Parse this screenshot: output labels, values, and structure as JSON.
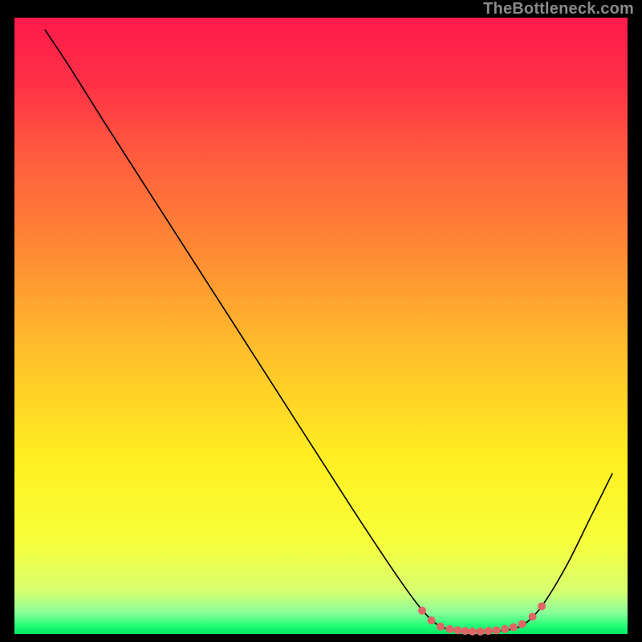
{
  "watermark": {
    "text": "TheBottleneck.com"
  },
  "chart_data": {
    "type": "line",
    "title": "",
    "xlabel": "",
    "ylabel": "",
    "xlim": [
      0,
      100
    ],
    "ylim": [
      0,
      100
    ],
    "grid": false,
    "legend": false,
    "background": {
      "type": "vertical-gradient",
      "stops": [
        {
          "pos": 0.0,
          "color": "#ff1a4b"
        },
        {
          "pos": 0.1,
          "color": "#ff2f47"
        },
        {
          "pos": 0.22,
          "color": "#ff5a3f"
        },
        {
          "pos": 0.38,
          "color": "#ff8a34"
        },
        {
          "pos": 0.55,
          "color": "#ffc22a"
        },
        {
          "pos": 0.72,
          "color": "#fff022"
        },
        {
          "pos": 0.85,
          "color": "#f7ff3a"
        },
        {
          "pos": 0.93,
          "color": "#d8ff70"
        },
        {
          "pos": 0.965,
          "color": "#8cff9a"
        },
        {
          "pos": 0.985,
          "color": "#2aff7a"
        },
        {
          "pos": 1.0,
          "color": "#00e865"
        }
      ]
    },
    "series": [
      {
        "name": "bottleneck-curve",
        "color": "#000000",
        "width": 1.6,
        "data": [
          {
            "x": 5.0,
            "y": 98.0
          },
          {
            "x": 9.0,
            "y": 92.0
          },
          {
            "x": 15.0,
            "y": 82.5
          },
          {
            "x": 25.0,
            "y": 67.0
          },
          {
            "x": 35.0,
            "y": 51.5
          },
          {
            "x": 45.0,
            "y": 36.0
          },
          {
            "x": 55.0,
            "y": 20.5
          },
          {
            "x": 62.0,
            "y": 10.0
          },
          {
            "x": 66.0,
            "y": 4.5
          },
          {
            "x": 69.0,
            "y": 1.5
          },
          {
            "x": 72.0,
            "y": 0.6
          },
          {
            "x": 76.0,
            "y": 0.4
          },
          {
            "x": 80.0,
            "y": 0.6
          },
          {
            "x": 83.0,
            "y": 1.5
          },
          {
            "x": 86.0,
            "y": 4.5
          },
          {
            "x": 90.0,
            "y": 11.0
          },
          {
            "x": 94.0,
            "y": 19.0
          },
          {
            "x": 97.5,
            "y": 26.0
          }
        ]
      }
    ],
    "markers": {
      "name": "optimal-zone-markers",
      "color": "#e06666",
      "radius": 5,
      "data": [
        {
          "x": 66.5,
          "y": 3.8
        },
        {
          "x": 68.0,
          "y": 2.2
        },
        {
          "x": 69.5,
          "y": 1.2
        },
        {
          "x": 71.0,
          "y": 0.8
        },
        {
          "x": 72.3,
          "y": 0.6
        },
        {
          "x": 73.5,
          "y": 0.5
        },
        {
          "x": 74.7,
          "y": 0.4
        },
        {
          "x": 76.0,
          "y": 0.4
        },
        {
          "x": 77.3,
          "y": 0.5
        },
        {
          "x": 78.6,
          "y": 0.6
        },
        {
          "x": 80.0,
          "y": 0.8
        },
        {
          "x": 81.4,
          "y": 1.1
        },
        {
          "x": 82.8,
          "y": 1.6
        },
        {
          "x": 84.5,
          "y": 2.8
        },
        {
          "x": 86.0,
          "y": 4.5
        }
      ]
    }
  }
}
